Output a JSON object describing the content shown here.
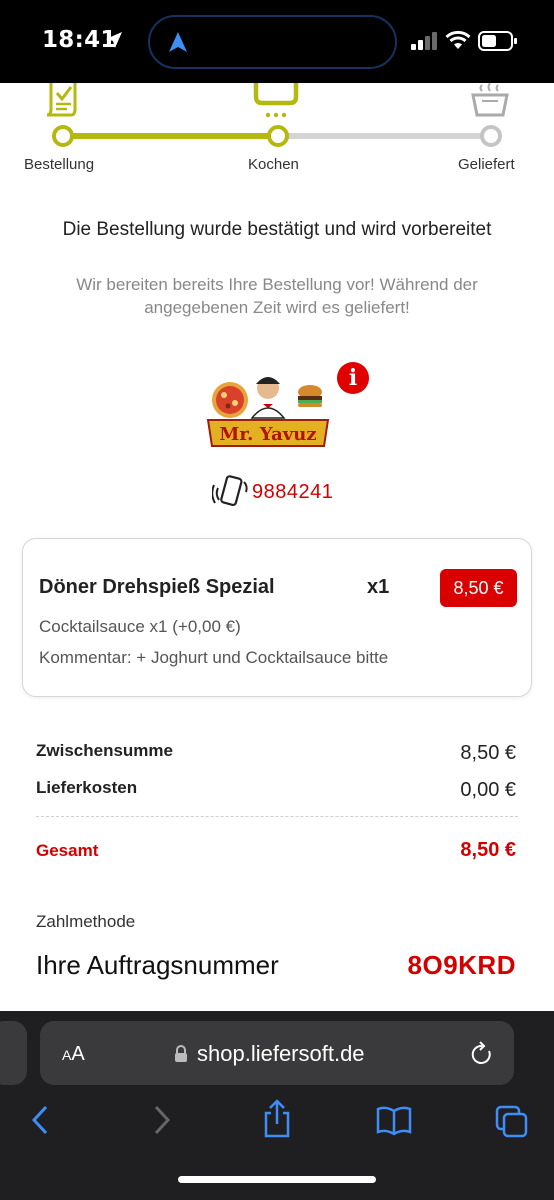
{
  "status_bar": {
    "time": "18:41"
  },
  "progress": {
    "steps": [
      {
        "label": "Bestellung",
        "icon": "order-document-icon",
        "state": "done"
      },
      {
        "label": "Kochen",
        "icon": "cooking-pot-icon",
        "state": "current"
      },
      {
        "label": "Geliefert",
        "icon": "delivered-bag-icon",
        "state": "pending"
      }
    ],
    "active_color": "#b5b80e",
    "inactive_color": "#d4d4d4"
  },
  "status": {
    "headline": "Die Bestellung wurde bestätigt und wird vorbereitet",
    "subline": "Wir bereiten bereits Ihre Bestellung vor! Während der angegebenen Zeit wird es geliefert!"
  },
  "restaurant": {
    "logo_text": "Mr. Yavuz",
    "info_icon": "info-icon",
    "info_glyph": "i",
    "phone": "9884241"
  },
  "order_item": {
    "name": "Döner Drehspieß Spezial",
    "quantity": "x1",
    "price": "8,50 €",
    "extra": "Cocktailsauce x1 (+0,00 €)",
    "comment": "Kommentar: + Joghurt und Cocktailsauce bitte"
  },
  "summary": {
    "subtotal_label": "Zwischensumme",
    "subtotal_value": "8,50 €",
    "delivery_label": "Lieferkosten",
    "delivery_value": "0,00 €",
    "total_label": "Gesamt",
    "total_value": "8,50 €"
  },
  "payment": {
    "method_label": "Zahlmethode",
    "order_number_label": "Ihre Auftragsnummer",
    "order_number": "8O9KRD"
  },
  "browser": {
    "text_size_label_small": "A",
    "text_size_label_large": "A",
    "url": "shop.liefersoft.de"
  },
  "colors": {
    "accent_red": "#d90000",
    "progress_green": "#b5b80e",
    "browser_blue": "#3d8ef7"
  }
}
